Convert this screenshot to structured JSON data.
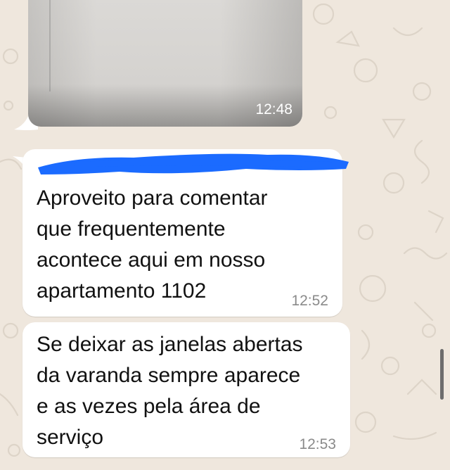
{
  "chat": {
    "background_color": "#efe7dd",
    "bubble_color": "#ffffff",
    "redaction_color": "#1b6bff",
    "messages": [
      {
        "type": "image",
        "time": "12:48"
      },
      {
        "type": "text",
        "sender_redacted": true,
        "text": "Aproveito para comentar\nque frequentemente\nacontece aqui em nosso\napartamento 1102",
        "time": "12:52"
      },
      {
        "type": "text",
        "text": "Se deixar as janelas abertas\nda varanda sempre aparece\ne as vezes pela área de\nserviço",
        "time": "12:53"
      }
    ]
  }
}
